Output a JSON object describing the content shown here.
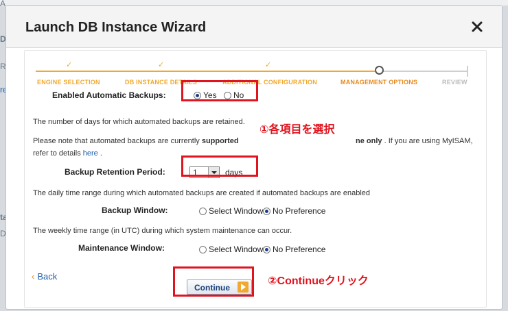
{
  "dialog": {
    "title": "Launch DB Instance Wizard"
  },
  "stepper": {
    "steps": [
      {
        "label": "ENGINE SELECTION",
        "state": "done"
      },
      {
        "label": "DB INSTANCE DETAILS",
        "state": "done"
      },
      {
        "label": "ADDITIONAL CONFIGURATION",
        "state": "done"
      },
      {
        "label": "MANAGEMENT OPTIONS",
        "state": "current"
      },
      {
        "label": "REVIEW",
        "state": "todo"
      }
    ],
    "check_glyph": "✓"
  },
  "form": {
    "automatic_backups": {
      "label": "Enabled Automatic Backups:",
      "yes": "Yes",
      "no": "No",
      "selected": "Yes"
    },
    "retention_desc": "The number of days for which automated backups are retained.",
    "note": {
      "prefix": "Please note that automated backups are currently",
      "bold_1": "supported",
      "bold_2": "ne only",
      "suffix": ". If you are using MyISAM,",
      "line2_prefix": "refer to details",
      "link": "here",
      "line2_suffix": "."
    },
    "retention": {
      "label": "Backup Retention Period:",
      "value": "1",
      "unit": "days"
    },
    "backup_window_desc": "The daily time range during which automated backups are created if automated backups are enabled",
    "backup_window": {
      "label": "Backup Window:",
      "option_1": "Select Window",
      "option_2": "No Preference",
      "selected": "No Preference"
    },
    "maintenance_desc": "The weekly time range (in UTC) during which system maintenance can occur.",
    "maintenance_window": {
      "label": "Maintenance Window:",
      "option_1": "Select Window",
      "option_2": "No Preference",
      "selected": "No Preference"
    }
  },
  "footer": {
    "back_chevron": "‹",
    "back_label": "Back",
    "continue_label": "Continue"
  },
  "annotations": {
    "note_1": "①各項目を選択",
    "note_2": "②Continueクリック"
  },
  "background": {
    "frag_1": "A",
    "frag_2": "D",
    "frag_3": "R",
    "frag_4": "re",
    "frag_5": "ta",
    "frag_6": "D"
  },
  "colors": {
    "accent_orange": "#f0a830",
    "highlight_red": "#e0141e",
    "link_blue": "#1f5fa8"
  }
}
